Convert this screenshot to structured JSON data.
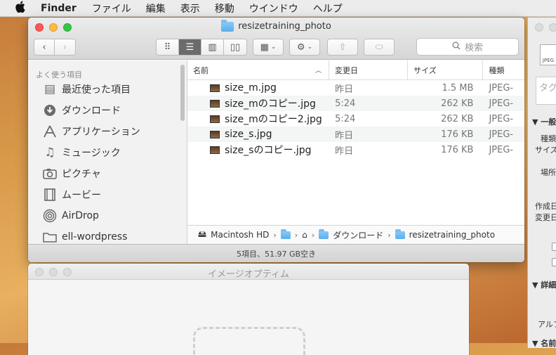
{
  "menubar": {
    "items": [
      "Finder",
      "ファイル",
      "編集",
      "表示",
      "移動",
      "ウインドウ",
      "ヘルプ"
    ]
  },
  "window": {
    "title": "resizetraining_photo",
    "search_placeholder": "検索"
  },
  "sidebar": {
    "section": "よく使う項目",
    "items": [
      {
        "label": "最近使った項目",
        "icon": "recent-icon"
      },
      {
        "label": "ダウンロード",
        "icon": "download-icon"
      },
      {
        "label": "アプリケーション",
        "icon": "applications-icon"
      },
      {
        "label": "ミュージック",
        "icon": "music-icon"
      },
      {
        "label": "ピクチャ",
        "icon": "camera-icon"
      },
      {
        "label": "ムービー",
        "icon": "film-icon"
      },
      {
        "label": "AirDrop",
        "icon": "airdrop-icon"
      },
      {
        "label": "ell-wordpress",
        "icon": "folder-icon"
      }
    ]
  },
  "list": {
    "columns": {
      "name": "名前",
      "date": "変更日",
      "size": "サイズ",
      "kind": "種類"
    },
    "rows": [
      {
        "name": "size_m.jpg",
        "date": "昨日",
        "size": "1.5 MB",
        "kind": "JPEG-"
      },
      {
        "name": "size_mのコピー.jpg",
        "date": "5:24",
        "size": "262 KB",
        "kind": "JPEG-"
      },
      {
        "name": "size_mのコピー2.jpg",
        "date": "5:24",
        "size": "262 KB",
        "kind": "JPEG-"
      },
      {
        "name": "size_s.jpg",
        "date": "昨日",
        "size": "176 KB",
        "kind": "JPEG-"
      },
      {
        "name": "size_sのコピー.jpg",
        "date": "昨日",
        "size": "176 KB",
        "kind": "JPEG-"
      }
    ]
  },
  "pathbar": {
    "segments": [
      "Macintosh HD",
      "",
      "",
      "ダウンロード",
      "resizetraining_photo"
    ]
  },
  "status": "5項目、51.97 GB空き",
  "second_window": {
    "title": "イメージオプティム"
  },
  "info_panel": {
    "tag_placeholder": "タグ",
    "section_general": "▼ 一般",
    "kind_label": "種類",
    "size_label": "サイズ",
    "where_label": "場所",
    "created_label": "作成日",
    "modified_label": "変更日",
    "section_more": "▼ 詳細",
    "alpha_label": "アルフ",
    "section_name": "▼ 名前",
    "jpeg_label": "JPEG"
  }
}
